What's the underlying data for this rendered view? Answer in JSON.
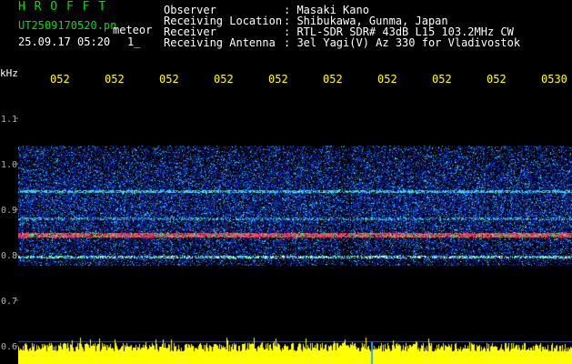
{
  "header": {
    "title": "H R O F F T",
    "filename": "UT2509170520.pn",
    "filename_suffix": "meteor",
    "datetime": "25.09.17 05:20",
    "marker": "1_",
    "labels": [
      "Observer",
      "Receiving Location",
      "Receiver",
      "Receiving Antenna"
    ],
    "values": [
      ": Masaki Kano",
      ": Shibukawa, Gunma, Japan",
      ": RTL-SDR SDR# 43dB L15 103.2MHz CW",
      ": 3el Yagi(V) Az 330 for Vladivostok"
    ]
  },
  "axis": {
    "unit": "kHz",
    "y_ticks": [
      "1.1",
      "1.0",
      "0.9",
      "0.8",
      "0.7",
      "0.6"
    ],
    "x_ticks": [
      "052",
      "052",
      "052",
      "052",
      "052",
      "052",
      "052",
      "052",
      "052",
      "0530"
    ]
  },
  "colors": {
    "background": "#000000",
    "noise_blue": "#1840c8",
    "cyan": "#00c8ff",
    "band_red": "#ff2040",
    "band_green": "#40ff60",
    "audio_yellow": "#ffff00",
    "header_green": "#00e000"
  }
}
